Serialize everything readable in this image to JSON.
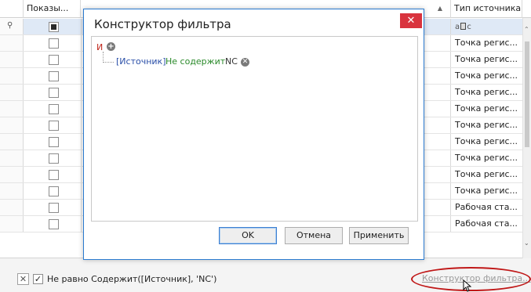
{
  "grid": {
    "headers": {
      "shown": "Показы...",
      "source_type": "Тип источника"
    },
    "filter_row": {
      "source_type_glyph_left": "a",
      "source_type_glyph_right": "c"
    },
    "rows": [
      {
        "source_type": "Точка регис..."
      },
      {
        "source_type": "Точка регис..."
      },
      {
        "source_type": "Точка регис..."
      },
      {
        "source_type": "Точка регис..."
      },
      {
        "source_type": "Точка регис..."
      },
      {
        "source_type": "Точка регис..."
      },
      {
        "source_type": "Точка регис..."
      },
      {
        "source_type": "Точка регис..."
      },
      {
        "source_type": "Точка регис..."
      },
      {
        "source_type": "Точка регис..."
      },
      {
        "source_type": "Рабочая ста..."
      },
      {
        "source_type": "Рабочая ста..."
      }
    ]
  },
  "dialog": {
    "title": "Конструктор фильтра",
    "close_symbol": "✕",
    "group_operator": "И",
    "condition": {
      "field": "[Источник]",
      "operator": "Не содержит",
      "value": "NC"
    },
    "buttons": {
      "ok": "OK",
      "cancel": "Отмена",
      "apply": "Применить"
    }
  },
  "filter_panel": {
    "clear_symbol": "✕",
    "enabled_mark": "✓",
    "expression": "Не равно Содержит([Источник], 'NC')",
    "builder_link": "Конструктор фильтра..."
  },
  "colors": {
    "accent_border": "#2b7bd0",
    "close_button": "#d9333d",
    "highlight_oval": "#c01818",
    "operator_and": "#c0281d",
    "condition_field": "#2a4fa8",
    "condition_operator": "#2a8a2a"
  }
}
